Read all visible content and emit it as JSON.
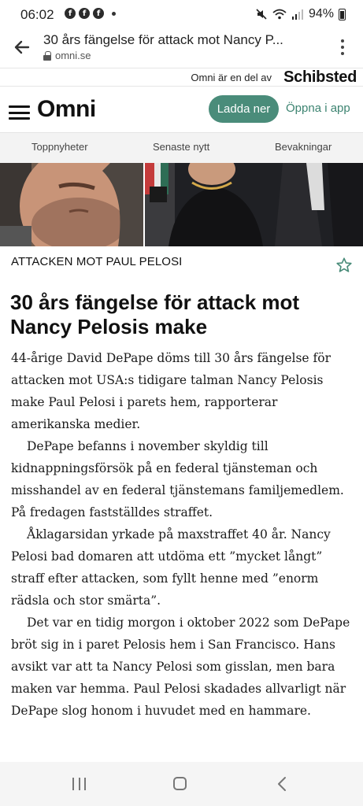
{
  "status_bar": {
    "time": "06:02",
    "battery": "94%",
    "notification_icons": [
      "facebook-icon",
      "facebook-icon",
      "facebook-icon"
    ]
  },
  "browser": {
    "page_title": "30 års fängelse för attack mot Nancy P...",
    "domain": "omni.se"
  },
  "publisher_strip": {
    "text": "Omni är en del av",
    "logo": "Schibsted"
  },
  "header": {
    "logo": "Omni",
    "download_label": "Ladda ner",
    "open_app_label": "Öppna i app"
  },
  "nav_tabs": [
    "Toppnyheter",
    "Senaste nytt",
    "Bevakningar"
  ],
  "article": {
    "kicker": "ATTACKEN MOT PAUL PELOSI",
    "headline": "30 års fängelse för attack mot Nancy Pelosis make",
    "paragraphs": [
      "44-årige David DePape döms till 30 års fängelse för attacken mot USA:s tidigare talman Nancy Pelosis make Paul Pelosi i parets hem, rapporterar amerikanska medier.",
      "DePape befanns i november skyldig till kidnappningsförsök på en federal tjänsteman och misshandel av en federal tjänstemans familjemedlem. På fredagen fastställdes straffet.",
      "Åklagarsidan yrkade på maxstraffet 40 år. Nancy Pelosi bad domaren att utdöma ett ”mycket långt” straff efter attacken, som fyllt henne med ”enorm rädsla och stor smärta”.",
      "Det var en tidig morgon i oktober 2022 som DePape bröt sig in i paret Pelosis hem i San Francisco. Hans avsikt var att ta Nancy Pelosi som gisslan, men bara maken var hemma. Paul Pelosi skadades allvarligt när DePape slog honom i huvudet med en hammare."
    ]
  },
  "colors": {
    "accent": "#4a8c7a",
    "accent_text": "#3d8471",
    "star": "#4a8c7a"
  }
}
